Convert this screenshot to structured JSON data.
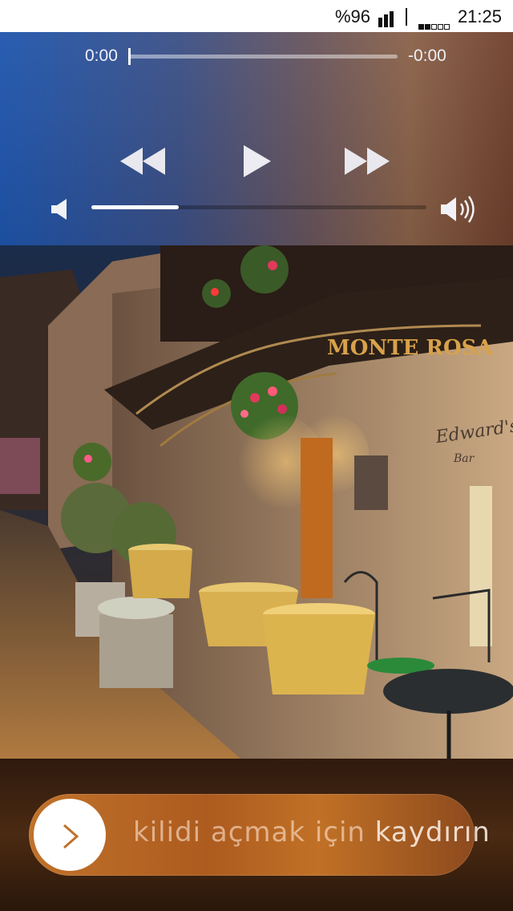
{
  "status_bar": {
    "battery": "%96",
    "time": "21:25",
    "wifi_level": 2
  },
  "player": {
    "elapsed": "0:00",
    "remaining": "-0:00",
    "progress": 0.0,
    "volume": 0.26,
    "icons": {
      "rewind": "rewind-icon",
      "play": "play-icon",
      "fast_forward": "fast-forward-icon",
      "volume_low": "volume-low-icon",
      "volume_high": "volume-high-icon"
    }
  },
  "artwork": {
    "sign_text": "MONTE ROSA",
    "sign2_text": "Edward's",
    "sign2_sub": "Bar"
  },
  "lock": {
    "slide_label_a": "kilidi açmak için ",
    "slide_label_b": "kaydırın",
    "knob_icon": "chevron-right-icon",
    "colors": {
      "accent": "#c0722a",
      "knob": "#ffffff"
    }
  }
}
